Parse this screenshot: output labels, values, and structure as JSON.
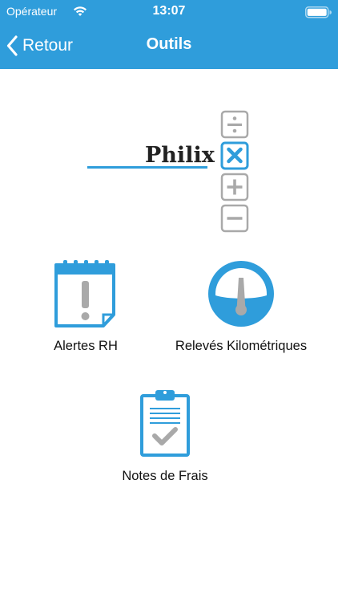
{
  "status_bar": {
    "carrier": "Opérateur",
    "time": "13:07"
  },
  "nav": {
    "back_label": "Retour",
    "title": "Outils"
  },
  "brand": {
    "name": "Philix"
  },
  "tools": [
    {
      "label": "Alertes RH",
      "icon": "calendar-alert-icon"
    },
    {
      "label": "Relevés Kilométriques",
      "icon": "speedometer-icon"
    },
    {
      "label": "Notes de Frais",
      "icon": "clipboard-check-icon"
    }
  ],
  "colors": {
    "accent": "#2f9ddb",
    "icon_gray": "#a9a9a9"
  }
}
